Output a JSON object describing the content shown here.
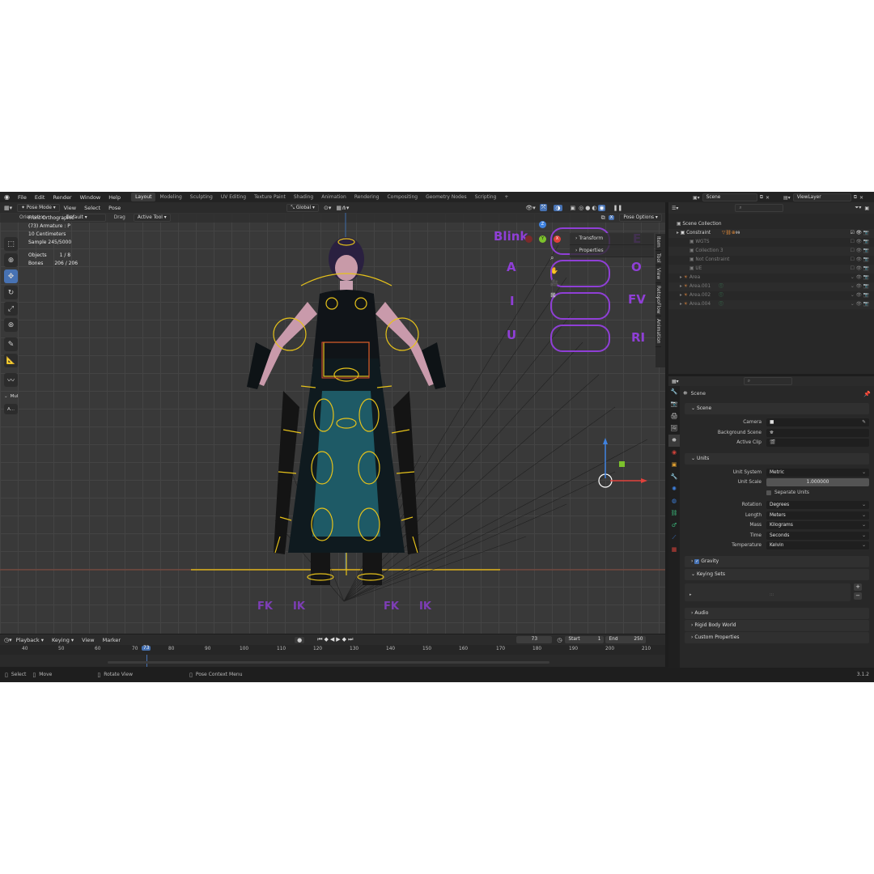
{
  "topbar": {
    "menus": [
      "File",
      "Edit",
      "Render",
      "Window",
      "Help"
    ],
    "workspaces": [
      "Layout",
      "Modeling",
      "Sculpting",
      "UV Editing",
      "Texture Paint",
      "Shading",
      "Animation",
      "Rendering",
      "Compositing",
      "Geometry Nodes",
      "Scripting"
    ],
    "add_tab": "+",
    "scene_name": "Scene",
    "view_layer_name": "ViewLayer"
  },
  "viewport_header": {
    "mode": "Pose Mode",
    "menus": [
      "View",
      "Select",
      "Pose"
    ],
    "transform_orientation": "Global"
  },
  "tool_header": {
    "orientation_label": "Orientation",
    "orientation_value": "Default",
    "drag_label": "Drag",
    "drag_value": "Active Tool",
    "pose_options": "Pose Options"
  },
  "viewport_info": {
    "view_name": "Front Orthographic",
    "object_line": "(73) Armature : P",
    "scale_line": "10 Centimeters",
    "sample_line": "Sample 245/5000",
    "objects_label": "Objects",
    "objects_value": "1 / 8",
    "bones_label": "Bones",
    "bones_value": "206 / 206"
  },
  "toolbar_extra": {
    "mul_label": "Mul",
    "a_label": "A..."
  },
  "npanel": {
    "tabs": [
      "Item",
      "Tool",
      "View",
      "RetopoFlow",
      "Animation"
    ],
    "rows": [
      "Transform",
      "Properties"
    ]
  },
  "rig_ui": {
    "blink": "Blink",
    "e": "E",
    "a": "A",
    "o": "O",
    "i": "I",
    "fv": "FV",
    "u": "U",
    "ri": "RI",
    "fk_left": "FK",
    "ik_left": "IK",
    "fk_right": "FK",
    "ik_right": "IK"
  },
  "gizmo": {
    "x": "X",
    "y": "Y",
    "z": "Z"
  },
  "timeline": {
    "menus": [
      "Playback",
      "Keying",
      "View",
      "Marker"
    ],
    "current_frame": "73",
    "start_label": "Start",
    "start_value": "1",
    "end_label": "End",
    "end_value": "250",
    "ruler_ticks": [
      "40",
      "50",
      "60",
      "70",
      "80",
      "90",
      "100",
      "110",
      "120",
      "130",
      "140",
      "150",
      "160",
      "170",
      "180",
      "190",
      "200",
      "210"
    ]
  },
  "statusbar": {
    "select": "Select",
    "move": "Move",
    "rotate_view": "Rotate View",
    "pose_context_menu": "Pose Context Menu",
    "version": "3.1.2"
  },
  "outliner": {
    "items": [
      {
        "label": "Scene Collection",
        "dim": false
      },
      {
        "label": "Constraint",
        "dim": false
      },
      {
        "label": "WGTS",
        "dim": true
      },
      {
        "label": "Collection 3",
        "dim": true
      },
      {
        "label": "Not Constraint",
        "dim": true
      },
      {
        "label": "UE",
        "dim": true
      },
      {
        "label": "Area",
        "dim": true
      },
      {
        "label": "Area.001",
        "dim": true
      },
      {
        "label": "Area.002",
        "dim": true
      },
      {
        "label": "Area.004",
        "dim": true
      }
    ],
    "badge": "99"
  },
  "properties": {
    "header": "Scene",
    "scene_section": "Scene",
    "camera_label": "Camera",
    "background_scene_label": "Background Scene",
    "active_clip_label": "Active Clip",
    "units_section": "Units",
    "unit_system_label": "Unit System",
    "unit_system_value": "Metric",
    "unit_scale_label": "Unit Scale",
    "unit_scale_value": "1.000000",
    "separate_units_label": "Separate Units",
    "rotation_label": "Rotation",
    "rotation_value": "Degrees",
    "length_label": "Length",
    "length_value": "Meters",
    "mass_label": "Mass",
    "mass_value": "Kilograms",
    "time_label": "Time",
    "time_value": "Seconds",
    "temperature_label": "Temperature",
    "temperature_value": "Kelvin",
    "gravity_section": "Gravity",
    "keying_sets_section": "Keying Sets",
    "audio_section": "Audio",
    "rigid_body_world_section": "Rigid Body World",
    "custom_properties_section": "Custom Properties"
  },
  "colors": {
    "accent_blue": "#4772b3",
    "bone_yellow": "#e6c21a",
    "rig_purple": "#8f3fd6",
    "axis_red": "#e0413b",
    "axis_green": "#7cc22c",
    "axis_blue": "#3f82e0"
  }
}
